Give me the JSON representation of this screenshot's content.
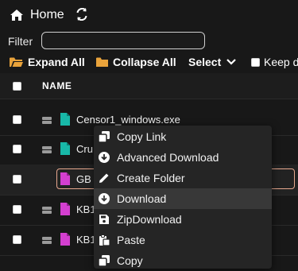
{
  "nav": {
    "home_label": "Home"
  },
  "filter": {
    "label": "Filter",
    "value": ""
  },
  "toolbar": {
    "expand_all": "Expand All",
    "collapse_all": "Collapse All",
    "select": "Select",
    "keep": "Keep d"
  },
  "table": {
    "name_header": "NAME"
  },
  "files": [
    {
      "name": "Censor1_windows.exe",
      "type": "exe"
    },
    {
      "name": "Cru",
      "type": "exe"
    },
    {
      "name": "GB",
      "type": "archive"
    },
    {
      "name": "KB1",
      "type": "archive"
    },
    {
      "name": "KB1",
      "type": "archive"
    }
  ],
  "context_menu": [
    {
      "label": "Copy Link",
      "icon": "copy-icon"
    },
    {
      "label": "Advanced Download",
      "icon": "download-circle-icon"
    },
    {
      "label": "Create Folder",
      "icon": "pencil-icon"
    },
    {
      "label": "Download",
      "icon": "download-circle-icon",
      "highlighted": true
    },
    {
      "label": "ZipDownload",
      "icon": "save-icon"
    },
    {
      "label": "Paste",
      "icon": "paste-icon"
    },
    {
      "label": "Copy",
      "icon": "copy-icon"
    }
  ],
  "colors": {
    "background": "#181818",
    "folder": "#e9a33b",
    "exe_icon": "#18b8a8",
    "archive_icon": "#d43fd0",
    "rename_border": "#e8a98f"
  }
}
